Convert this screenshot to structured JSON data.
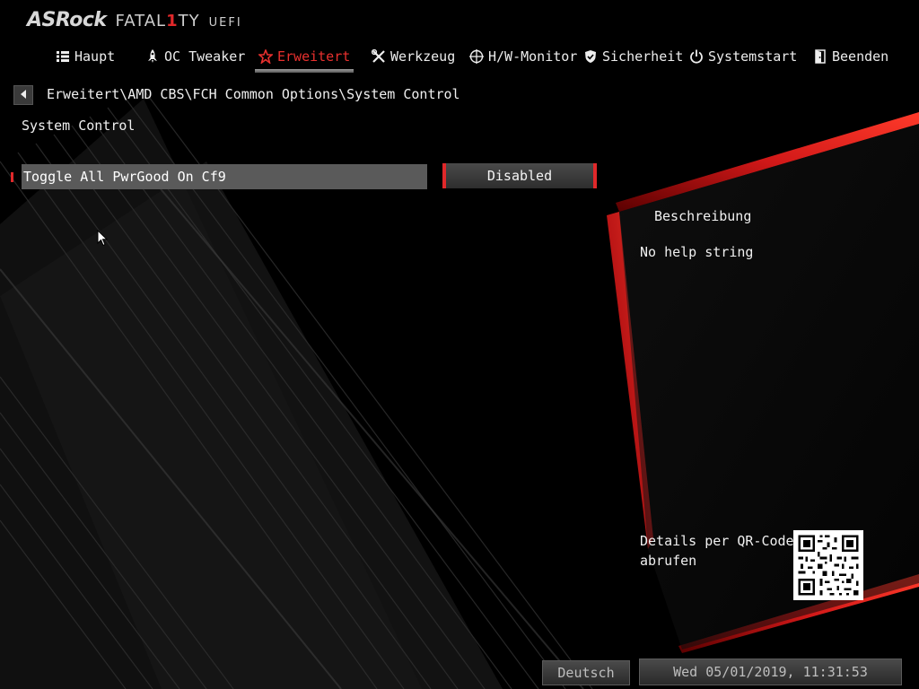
{
  "brand": {
    "logo_main": "ASRock",
    "logo_series_a": "FATAL",
    "logo_series_one": "1",
    "logo_series_b": "TY",
    "logo_suffix": "UEFI"
  },
  "nav": {
    "items": [
      {
        "label": "Haupt",
        "icon": "list-icon"
      },
      {
        "label": "OC Tweaker",
        "icon": "rocket-icon"
      },
      {
        "label": "Erweitert",
        "icon": "star-icon",
        "active": true
      },
      {
        "label": "Werkzeug",
        "icon": "tools-icon"
      },
      {
        "label": "H/W-Monitor",
        "icon": "crosshair-icon"
      },
      {
        "label": "Sicherheit",
        "icon": "shield-icon"
      },
      {
        "label": "Systemstart",
        "icon": "power-icon"
      },
      {
        "label": "Beenden",
        "icon": "exit-door-icon"
      }
    ]
  },
  "breadcrumb": "Erweitert\\AMD CBS\\FCH Common Options\\System Control",
  "section_title": "System Control",
  "options": [
    {
      "label": "Toggle All PwrGood On Cf9",
      "value": "Disabled"
    }
  ],
  "description": {
    "title": "Beschreibung",
    "text": "No help string",
    "qr_label_line1": "Details per QR-Code",
    "qr_label_line2": "abrufen"
  },
  "status": {
    "language": "Deutsch",
    "datetime": "Wed 05/01/2019, 11:31:53"
  },
  "colors": {
    "accent": "#e0282a",
    "background": "#000000",
    "text": "#f0f0f0"
  }
}
